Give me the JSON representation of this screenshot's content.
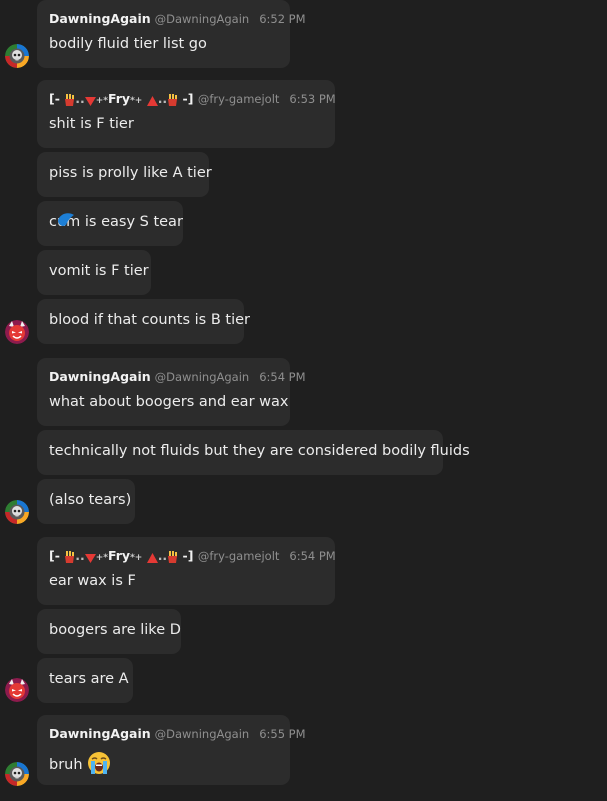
{
  "users": {
    "dawning": {
      "name": "DawningAgain",
      "handle": "@DawningAgain"
    },
    "fry": {
      "name_prefix": "[-",
      "name_core": "Fry",
      "name_suffix": "-]",
      "handle": "@fry-gamejolt"
    }
  },
  "groups": [
    {
      "user": "dawning",
      "time": "6:52 PM",
      "messages": [
        "bodily fluid tier list go"
      ]
    },
    {
      "user": "fry",
      "time": "6:53 PM",
      "messages": [
        "shit is F tier",
        "piss is prolly like A tier",
        "cum is easy S tear",
        "vomit is F tier",
        "blood if that counts is B tier"
      ]
    },
    {
      "user": "dawning",
      "time": "6:54 PM",
      "messages": [
        "what about boogers and ear wax",
        "technically not fluids but they are considered bodily fluids",
        "(also tears)"
      ]
    },
    {
      "user": "fry",
      "time": "6:54 PM",
      "messages": [
        "ear wax is F",
        "boogers are like D",
        "tears are A"
      ]
    },
    {
      "user": "dawning",
      "time": "6:55 PM",
      "messages": [
        "bruh"
      ]
    }
  ],
  "icons": {
    "dawning_avatar": "rainbow-skull-avatar",
    "fry_avatar": "red-devil-avatar",
    "bruh_emoji": "crying-face-emoji",
    "fry_decor": [
      "fries-icon",
      "triangle-icon",
      "sparkle-icon"
    ]
  },
  "colors": {
    "background": "#1f1f1f",
    "bubble": "#2c2c2c",
    "text": "#ececec",
    "meta": "#8f8f8f",
    "accent_blue": "#1d7fd6",
    "fries_red": "#d63b2f"
  }
}
